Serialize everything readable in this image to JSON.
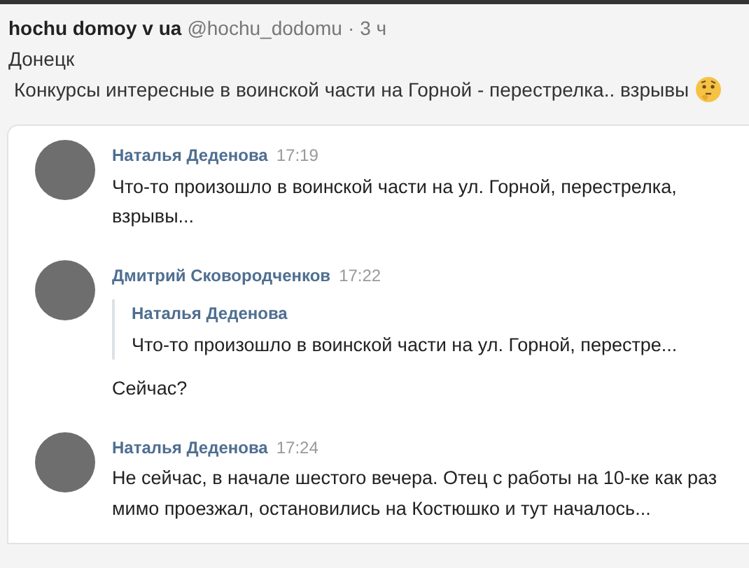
{
  "post": {
    "author": "hochu domoy v ua",
    "handle": "@hochu_dodomu",
    "separator": "·",
    "time": "3 ч",
    "location": "Донецк",
    "text": "Конкурсы интересные в воинской части на Горной - перестрелка.. взрывы"
  },
  "embedded_chat": {
    "messages": [
      {
        "author": "Наталья Деденова",
        "time": "17:19",
        "text": "Что-то произошло в воинской части на ул. Горной, перестрелка, взрывы..."
      },
      {
        "author": "Дмитрий Сковородченков",
        "time": "17:22",
        "quote": {
          "author": "Наталья Деденова",
          "text": "Что-то произошло в воинской части на ул. Горной, перестре..."
        },
        "text": "Сейчас?"
      },
      {
        "author": "Наталья Деденова",
        "time": "17:24",
        "text": "Не сейчас, в начале шестого вечера. Отец с работы на 10-ке как раз мимо проезжал, остановились на Костюшко и тут началось..."
      }
    ]
  }
}
